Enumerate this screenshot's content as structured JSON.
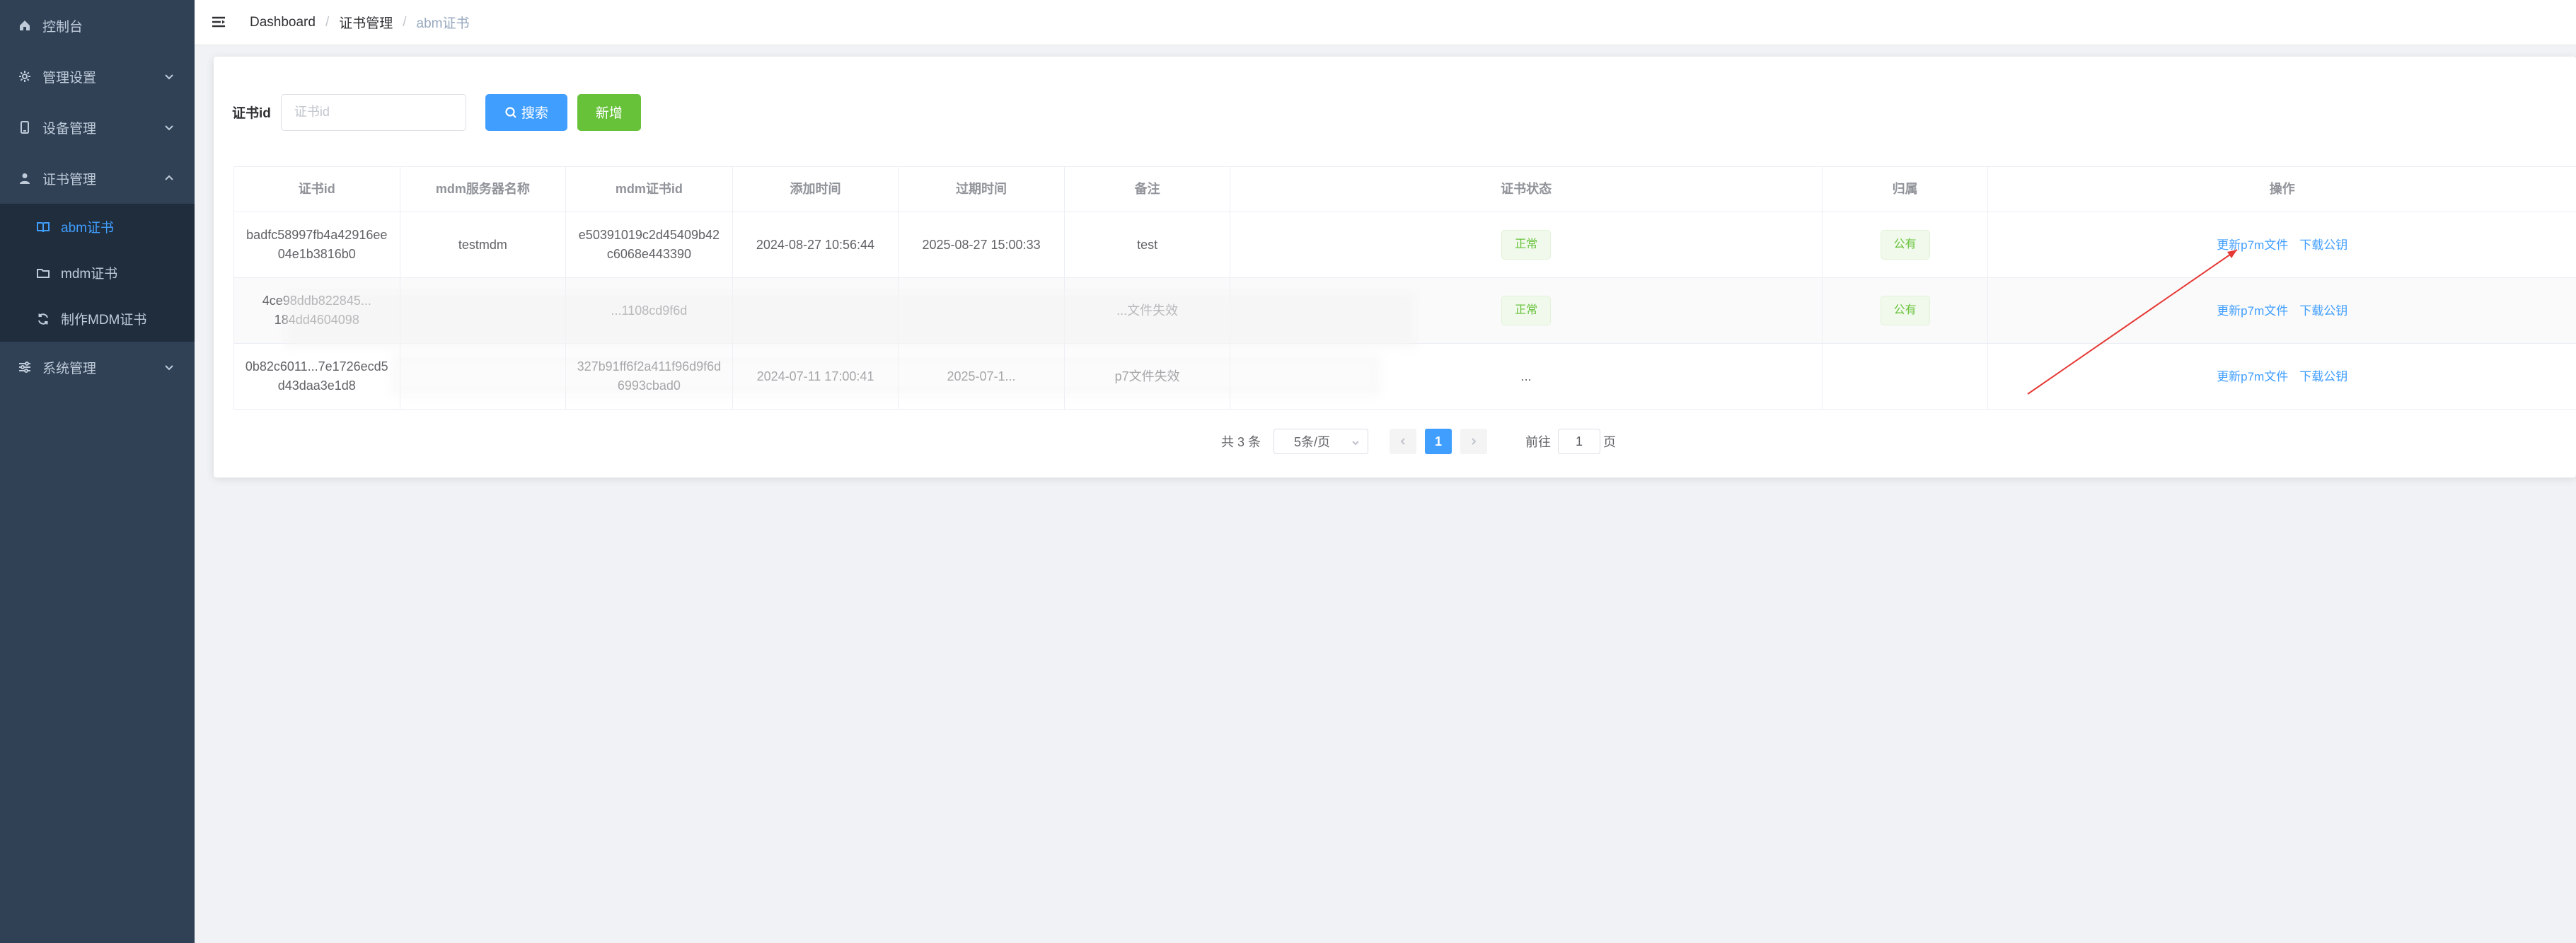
{
  "sidebar": {
    "items": [
      {
        "label": "控制台",
        "icon": "home-icon"
      },
      {
        "label": "管理设置",
        "icon": "gear-icon"
      },
      {
        "label": "设备管理",
        "icon": "device-icon"
      },
      {
        "label": "证书管理",
        "icon": "user-icon"
      }
    ],
    "cert_sub": [
      {
        "label": "abm证书",
        "icon": "book-icon"
      },
      {
        "label": "mdm证书",
        "icon": "folder-icon"
      },
      {
        "label": "制作MDM证书",
        "icon": "refresh-icon"
      }
    ],
    "system": {
      "label": "系统管理",
      "icon": "sliders-icon"
    }
  },
  "breadcrumb": [
    "Dashboard",
    "证书管理",
    "abm证书"
  ],
  "search": {
    "label": "证书id",
    "placeholder": "证书id",
    "search_button": "搜索",
    "add_button": "新增"
  },
  "table": {
    "headers": [
      "证书id",
      "mdm服务器名称",
      "mdm证书id",
      "添加时间",
      "过期时间",
      "备注",
      "证书状态",
      "归属",
      "操作"
    ],
    "rows": [
      {
        "cert_id_1": "badfc58997fb4a42916ee",
        "cert_id_2": "04e1b3816b0",
        "server": "testmdm",
        "mdm_id_1": "e50391019c2d45409b42",
        "mdm_id_2": "c6068e443390",
        "added": "2024-08-27 10:56:44",
        "expires": "2025-08-27 15:00:33",
        "note": "test",
        "status": "正常",
        "owner": "公有",
        "action_update": "更新p7m文件",
        "action_download": "下载公钥"
      },
      {
        "cert_id_1": "4ce98ddb822845...",
        "cert_id_2": "184dd4604098",
        "server": "",
        "mdm_id_1": "...1108cd9f6d",
        "mdm_id_2": "",
        "added": "",
        "expires": "",
        "note": "...文件失效",
        "status": "正常",
        "owner": "公有",
        "action_update": "更新p7m文件",
        "action_download": "下载公钥"
      },
      {
        "cert_id_1": "0b82c6011...7e1726ecd5",
        "cert_id_2": "d43daa3e1d8",
        "server": "",
        "mdm_id_1": "327b91ff6f2a411f96d9f6d",
        "mdm_id_2": "6993cbad0",
        "added": "2024-07-11 17:00:41",
        "expires": "2025-07-1...",
        "note": "p7文件失效",
        "status": "...",
        "owner": "",
        "action_update": "更新p7m文件",
        "action_download": "下载公钥"
      }
    ]
  },
  "pagination": {
    "total": "共 3 条",
    "page_size": "5条/页",
    "current_page": "1",
    "goto_label": "前往",
    "goto_value": "1",
    "page_suffix": "页"
  },
  "colors": {
    "sidebar_bg": "#304156",
    "submenu_bg": "#1f2d3d",
    "primary": "#409eff",
    "success": "#67c23a",
    "annotation": "#e53935"
  }
}
